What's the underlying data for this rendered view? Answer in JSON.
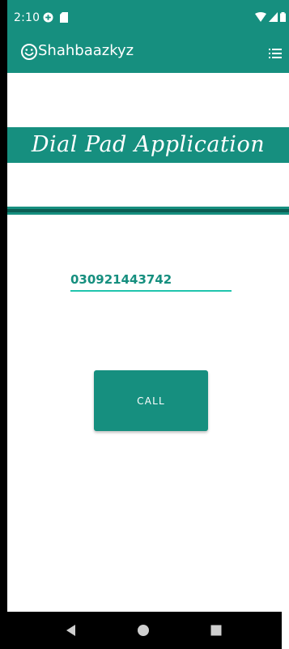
{
  "status_bar": {
    "time": "2:10",
    "icons_left": [
      "data-saver-icon",
      "sd-card-icon"
    ],
    "icons_right": [
      "wifi-icon",
      "signal-icon",
      "battery-icon"
    ]
  },
  "app_bar": {
    "title": "Shahbaazkyz",
    "logo_icon": "smiley-icon",
    "menu_icon": "list-menu-icon"
  },
  "banner": {
    "text": "Dial Pad Application"
  },
  "dialer": {
    "phone_number": "030921443742",
    "call_label": "CALL"
  },
  "nav_bar": {
    "icons": [
      "back-icon",
      "home-icon",
      "recents-icon"
    ]
  },
  "colors": {
    "primary": "#168f7f",
    "primary_dark": "#0c5e54",
    "accent": "#20c4ad",
    "background": "#ffffff"
  }
}
